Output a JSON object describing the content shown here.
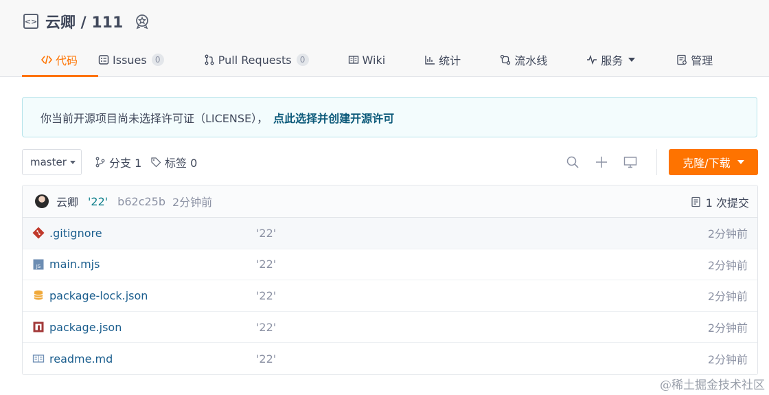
{
  "repo": {
    "title": "云卿 / 111"
  },
  "tabs": [
    {
      "label": "代码",
      "active": true
    },
    {
      "label": "Issues",
      "count": "0"
    },
    {
      "label": "Pull Requests",
      "count": "0"
    },
    {
      "label": "Wiki"
    },
    {
      "label": "统计"
    },
    {
      "label": "流水线"
    },
    {
      "label": "服务"
    },
    {
      "label": "管理"
    }
  ],
  "notice": {
    "text": "你当前开源项目尚未选择许可证（LICENSE），",
    "link": "点此选择并创建开源许可"
  },
  "toolbar": {
    "branch": "master",
    "branches_label": "分支 1",
    "tags_label": "标签 0",
    "clone_label": "克隆/下载"
  },
  "commit": {
    "author": "云卿",
    "message": "'22'",
    "hash": "b62c25b",
    "time": "2分钟前",
    "count_label": "1 次提交"
  },
  "files": [
    {
      "name": ".gitignore",
      "message": "'22'",
      "time": "2分钟前",
      "icon": "git-icon"
    },
    {
      "name": "main.mjs",
      "message": "'22'",
      "time": "2分钟前",
      "icon": "js-file-icon"
    },
    {
      "name": "package-lock.json",
      "message": "'22'",
      "time": "2分钟前",
      "icon": "database-icon"
    },
    {
      "name": "package.json",
      "message": "'22'",
      "time": "2分钟前",
      "icon": "npm-icon"
    },
    {
      "name": "readme.md",
      "message": "'22'",
      "time": "2分钟前",
      "icon": "book-icon"
    }
  ],
  "watermark": "@稀土掘金技术社区",
  "colors": {
    "accent": "#fe7300",
    "link": "#1b5e8e",
    "notice_bg": "#f3fcfd"
  }
}
